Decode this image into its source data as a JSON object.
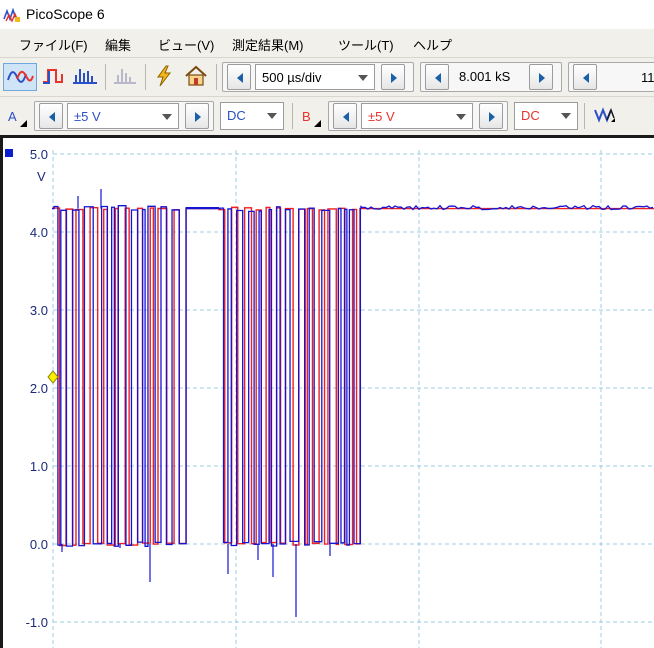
{
  "window": {
    "title": "PicoScope 6"
  },
  "menu": [
    "ファイル(F)",
    "編集",
    "ビュー(V)",
    "測定結果(M)",
    "ツール(T)",
    "ヘルプ"
  ],
  "toolbar": {
    "timebase": "500 µs/div",
    "samples": "8.001 kS",
    "captures_partial": "11"
  },
  "channels": {
    "a": {
      "name": "A",
      "range": "±5 V",
      "coupling": "DC",
      "color": "#2a50c8"
    },
    "b": {
      "name": "B",
      "range": "±5 V",
      "coupling": "DC",
      "color": "#e8322d"
    }
  },
  "plot": {
    "unit": "V",
    "y_ticks": [
      "5.0",
      "4.0",
      "3.0",
      "2.0",
      "1.0",
      "0.0",
      "-1.0"
    ],
    "grid_color": "#9ecbe6",
    "trace_a_color": "#1414d2",
    "trace_b_color": "#f01e1e"
  },
  "chart_data": {
    "type": "line",
    "ylim": [
      -1.3,
      5.0
    ],
    "ylabel": "V",
    "description_free": true
  }
}
